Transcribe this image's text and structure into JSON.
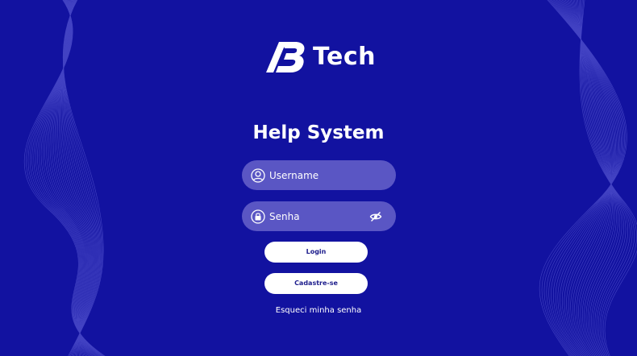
{
  "brand": {
    "logo_text": "Tech",
    "logo_mark": "AB"
  },
  "page": {
    "title": "Help System"
  },
  "form": {
    "username_placeholder": "Username",
    "password_placeholder": "Senha",
    "login_label": "Login",
    "signup_label": "Cadastre-se",
    "forgot_label": "Esqueci minha senha"
  },
  "icons": {
    "username": "user-icon",
    "password": "lock-icon",
    "toggle_visibility": "eye-slash-icon"
  },
  "colors": {
    "background": "#1212a0",
    "field_background": "#5a56c4",
    "button_background": "#ffffff",
    "button_text": "#1c1c8c",
    "text": "#ffffff"
  }
}
